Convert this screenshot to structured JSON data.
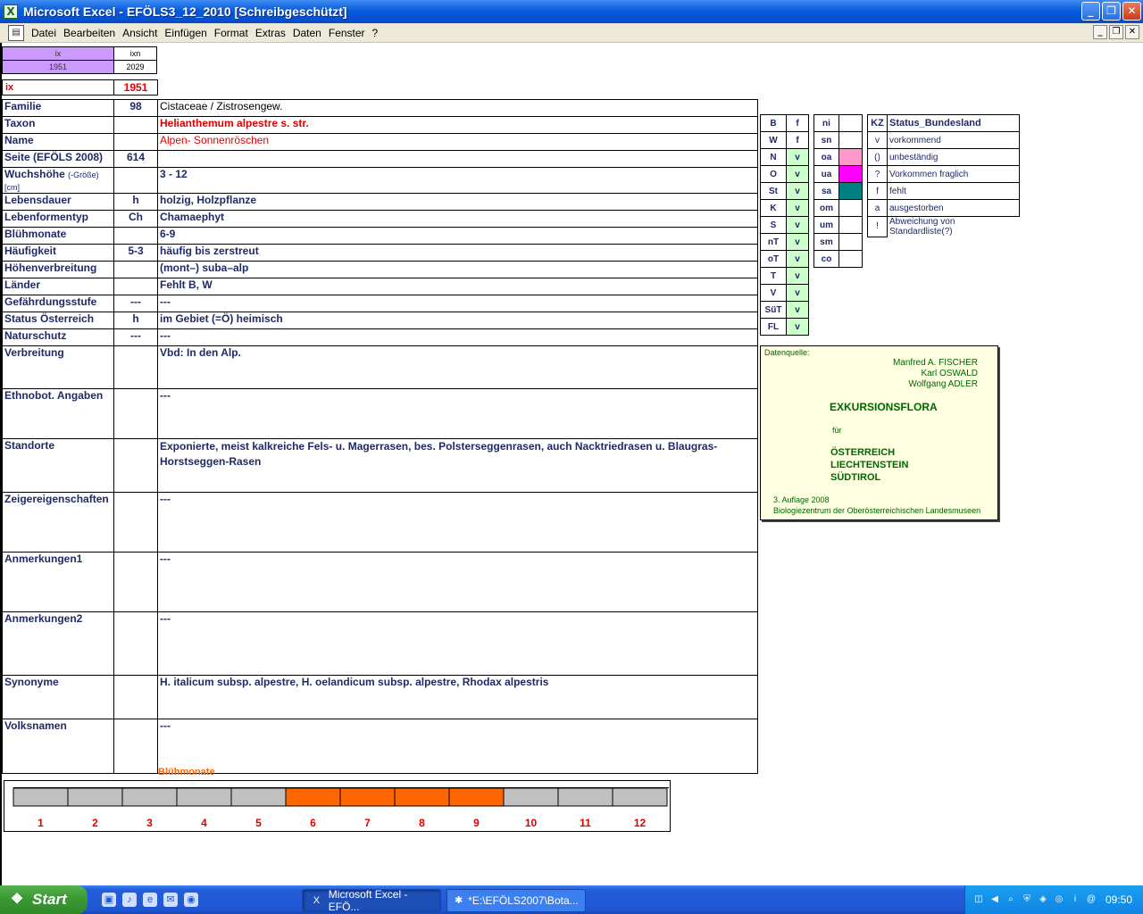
{
  "window": {
    "title": "Microsoft Excel - EFÖLS3_12_2010  [Schreibgeschützt]",
    "app_icon": "excel-icon",
    "buttons": {
      "minimize": "_",
      "restore": "❐",
      "close": "✕"
    }
  },
  "menu": {
    "items": [
      "Datei",
      "Bearbeiten",
      "Ansicht",
      "Einfügen",
      "Format",
      "Extras",
      "Daten",
      "Fenster",
      "?"
    ],
    "mdi_buttons": {
      "minimize": "_",
      "restore": "❐",
      "close": "✕"
    }
  },
  "idbox": {
    "h1": "ix",
    "h2": "ixn",
    "v1": "1951",
    "v2": "2029"
  },
  "ix": {
    "label": "ix",
    "value": "1951"
  },
  "rows": [
    {
      "label": "Familie",
      "code": "98",
      "value": "Cistaceae  /  Zistrosengew."
    },
    {
      "label": "Taxon",
      "code": "",
      "value": "Helianthemum alpestre s. str."
    },
    {
      "label": "Name",
      "code": "",
      "value": "Alpen- Sonnenröschen"
    },
    {
      "label": "Seite (EFÖLS 2008)",
      "code": "614",
      "value": ""
    },
    {
      "label": "Wuchshöhe",
      "label_small": "(-Größe) [cm]",
      "code": "",
      "value": " 3 - 12"
    },
    {
      "label": "Lebensdauer",
      "code": "h",
      "value": "holzig, Holzpflanze"
    },
    {
      "label": "Lebenformentyp",
      "code": "Ch",
      "value": "Chamaephyt"
    },
    {
      "label": "Blühmonate",
      "code": "",
      "value": " 6-9"
    },
    {
      "label": "Häufigkeit",
      "code": "5-3",
      "value": "häufig bis zerstreut"
    },
    {
      "label": "Höhenverbreitung",
      "code": "",
      "value": "(mont–) suba–alp"
    },
    {
      "label": "Länder",
      "code": "",
      "value": "Fehlt B, W"
    },
    {
      "label": "Gefährdungsstufe",
      "code": "---",
      "value": "   ---"
    },
    {
      "label": "Status Österreich",
      "code": "h",
      "value": "im Gebiet (=Ö) heimisch"
    },
    {
      "label": "Naturschutz",
      "code": "---",
      "value": " ---"
    },
    {
      "label": "Verbreitung",
      "code": "",
      "value": "Vbd: In den Alp."
    },
    {
      "label": "Ethnobot. Angaben",
      "code": "",
      "value": "---"
    },
    {
      "label": "Standorte",
      "code": "",
      "value": "Exponierte, meist kalkreiche Fels- u. Magerrasen, bes. Polsterseggenrasen, auch Nacktriedrasen u. Blaugras-Horstseggen-Rasen"
    },
    {
      "label": "Zeigereigenschaften",
      "code": "",
      "value": "---"
    },
    {
      "label": "Anmerkungen1",
      "code": "",
      "value": "---"
    },
    {
      "label": "Anmerkungen2",
      "code": "",
      "value": "---"
    },
    {
      "label": "Synonyme",
      "code": "",
      "value": "H. italicum subsp. alpestre, H. oelandicum subsp. alpestre, Rhodax alpestris"
    },
    {
      "label": "Volksnamen",
      "code": "",
      "value": "---"
    }
  ],
  "bundeslaender": [
    {
      "kz": "B",
      "v": "f"
    },
    {
      "kz": "W",
      "v": "f"
    },
    {
      "kz": "N",
      "v": "v"
    },
    {
      "kz": "O",
      "v": "v"
    },
    {
      "kz": "St",
      "v": "v"
    },
    {
      "kz": "K",
      "v": "v"
    },
    {
      "kz": "S",
      "v": "v"
    },
    {
      "kz": "nT",
      "v": "v"
    },
    {
      "kz": "oT",
      "v": "v"
    },
    {
      "kz": "T",
      "v": "v"
    },
    {
      "kz": "V",
      "v": "v"
    },
    {
      "kz": "SüT",
      "v": "v"
    },
    {
      "kz": "FL",
      "v": "v"
    }
  ],
  "indigen": [
    "ni",
    "sn",
    "oa",
    "ua",
    "sa",
    "om",
    "um",
    "sm",
    "co"
  ],
  "status_legend": {
    "head_kz": "KZ",
    "head_desc": "Status_Bundesland",
    "items": [
      {
        "kz": "v",
        "desc": "vorkommend"
      },
      {
        "kz": "()",
        "desc": "unbeständig"
      },
      {
        "kz": "?",
        "desc": "Vorkommen fraglich"
      },
      {
        "kz": "f",
        "desc": "fehlt"
      },
      {
        "kz": "a",
        "desc": "ausgestorben"
      },
      {
        "kz": "!",
        "desc": "Abweichung von Standardliste(?)"
      }
    ]
  },
  "source": {
    "header": "Datenquelle:",
    "authors": [
      "Manfred A. FISCHER",
      "Karl OSWALD",
      "Wolfgang ADLER"
    ],
    "title": "EXKURSIONSFLORA",
    "fuer": "für",
    "countries": [
      "ÖSTERREICH",
      "LIECHTENSTEIN",
      "SÜDTIROL"
    ],
    "edition": "3. Auflage 2008",
    "publisher": "Biologiezentrum der Oberösterreichischen Landesmuseen"
  },
  "chart_data": {
    "type": "bar",
    "title": "Blühmonate",
    "categories": [
      "1",
      "2",
      "3",
      "4",
      "5",
      "6",
      "7",
      "8",
      "9",
      "10",
      "11",
      "12"
    ],
    "values": [
      0,
      0,
      0,
      0,
      0,
      1,
      1,
      1,
      1,
      0,
      0,
      0
    ],
    "colors": {
      "bloom": "#ff6600",
      "none": "#c0c0c0",
      "label": "#e00000"
    }
  },
  "taskbar": {
    "start": "Start",
    "tasks": [
      {
        "label": "Microsoft Excel - EFÖ...",
        "icon": "excel-icon",
        "active": true
      },
      {
        "label": "*E:\\EFÖLS2007\\Bota...",
        "icon": "document-icon",
        "active": false
      }
    ],
    "clock": "09:50"
  }
}
